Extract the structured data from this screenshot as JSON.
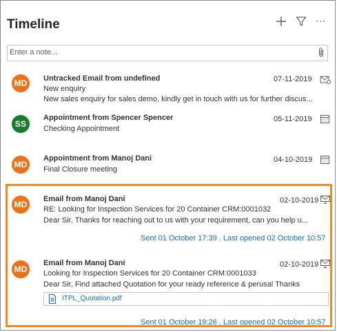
{
  "header": {
    "title": "Timeline"
  },
  "note": {
    "placeholder": "Enter a note..."
  },
  "colors": {
    "orange": "#e8731a",
    "green": "#1a7a2e",
    "link": "#0f6cbd",
    "highlight": "#f08a1f"
  },
  "items": [
    {
      "initials": "MD",
      "avatar_color": "#e8731a",
      "title": "Untracked Email from undefined",
      "date": "07-11-2019",
      "line1": "New enquiry",
      "line2": "New sales enquiry for sales demo, kindly get in touch with us for further discus...",
      "type_icon": "email-icon"
    },
    {
      "initials": "SS",
      "avatar_color": "#1a7a2e",
      "title": "Appointment from Spencer Spencer",
      "date": "05-11-2019",
      "line1": "Checking Appointment",
      "type_icon": "calendar-icon"
    },
    {
      "initials": "MD",
      "avatar_color": "#e8731a",
      "title": "Appointment from Manoj Dani",
      "date": "04-10-2019",
      "line1": "Final Closure meeting",
      "type_icon": "calendar-icon"
    },
    {
      "initials": "MD",
      "avatar_color": "#e8731a",
      "title": "Email from Manoj Dani",
      "date": "02-10-2019",
      "line1": "RE: Looking for Inspection Services for 20 Container CRM:0001032",
      "line2": "Dear Sir, Thanks for reaching out to us with your requirement,  can you help u...",
      "status": "Sent 01 October 17:39 . Last opened 02 October 10:57",
      "type_icon": "email-open-icon"
    },
    {
      "initials": "MD",
      "avatar_color": "#e8731a",
      "title": "Email from Manoj Dani",
      "date": "02-10-2019",
      "line1": "Looking for Inspection Services for 20 Container CRM:0001033",
      "line2": "Dear Sir, Find attached Quotation for your ready reference & perusal Thanks",
      "attachment": "ITPL_Quotation.pdf",
      "status": "Sent 01 October 19:26 . Last opened 02 October 10:57",
      "type_icon": "email-open-icon"
    }
  ]
}
